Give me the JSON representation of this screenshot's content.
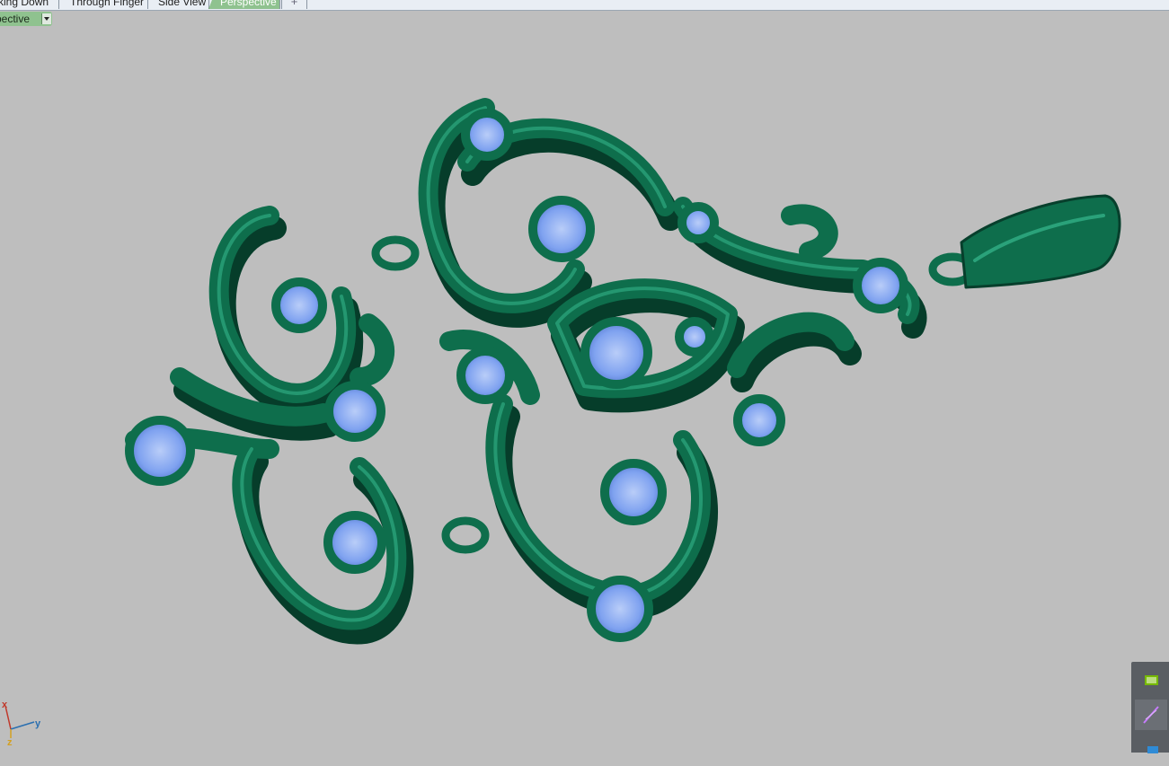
{
  "tabs": [
    {
      "label": "king Down",
      "active": false
    },
    {
      "label": "Through Finger",
      "active": false
    },
    {
      "label": "Side View",
      "active": false
    },
    {
      "label": "Perspective",
      "active": true
    }
  ],
  "add_tab_icon": "plus-icon",
  "viewport_label": "spective",
  "axes": {
    "x": "x",
    "y": "y",
    "z": "z"
  },
  "colors": {
    "background": "#bebebe",
    "metal": "#0e6e4c",
    "gem": "#7fa2f0",
    "active_tab": "#8fc28f"
  },
  "tray_icons": [
    "nvidia-icon",
    "feather-pen-icon",
    "shield-icon"
  ]
}
